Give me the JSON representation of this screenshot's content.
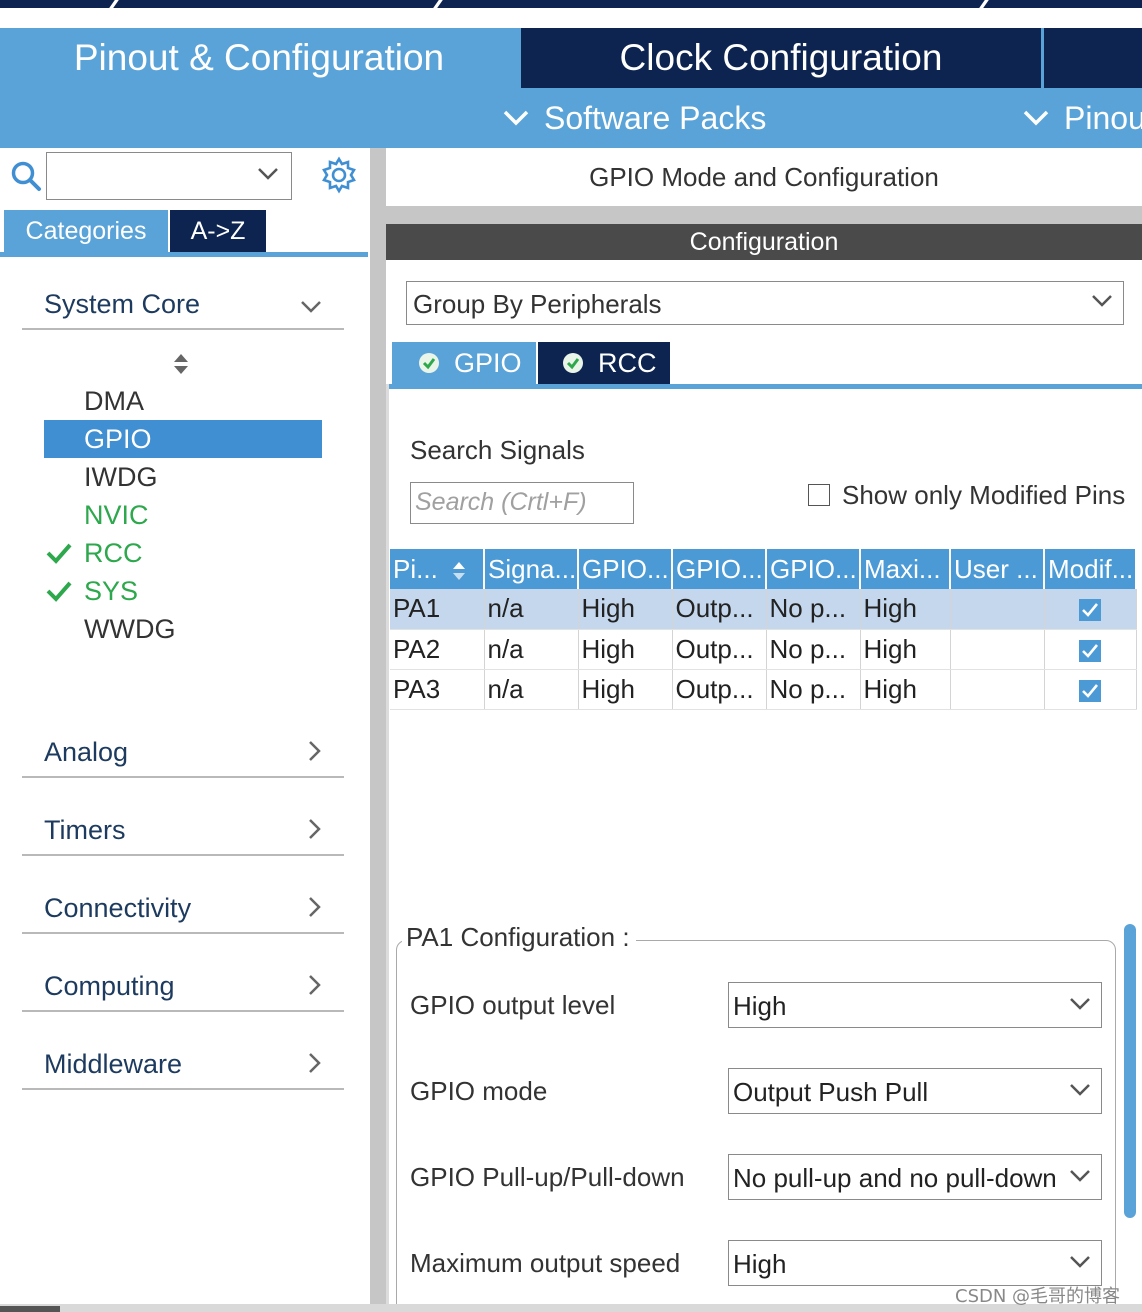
{
  "top_tabs": {
    "pinout": "Pinout & Configuration",
    "clock": "Clock Configuration"
  },
  "sub_menu": {
    "software_packs": "Software Packs",
    "pinout": "Pinou"
  },
  "left": {
    "search_value": "",
    "tabs": {
      "categories": "Categories",
      "az": "A->Z"
    },
    "groups": {
      "system_core": "System Core",
      "analog": "Analog",
      "timers": "Timers",
      "connectivity": "Connectivity",
      "computing": "Computing",
      "middleware": "Middleware"
    },
    "peripherals": [
      "DMA",
      "GPIO",
      "IWDG",
      "NVIC",
      "RCC",
      "SYS",
      "WWDG"
    ]
  },
  "right": {
    "mode_title": "GPIO Mode and Configuration",
    "configuration_bar": "Configuration",
    "group_by": "Group By Peripherals",
    "tabs": {
      "gpio": "GPIO",
      "rcc": "RCC"
    },
    "search_signals_label": "Search Signals",
    "search_placeholder": "Search (Crtl+F)",
    "show_modified_label": "Show only Modified Pins",
    "table": {
      "headers": [
        "Pi...",
        "Signa...",
        "GPIO...",
        "GPIO...",
        "GPIO...",
        "Maxi...",
        "User ...",
        "Modif..."
      ],
      "rows": [
        [
          "PA1",
          "n/a",
          "High",
          "Outp...",
          "No p...",
          "High",
          "",
          "checked"
        ],
        [
          "PA2",
          "n/a",
          "High",
          "Outp...",
          "No p...",
          "High",
          "",
          "checked"
        ],
        [
          "PA3",
          "n/a",
          "High",
          "Outp...",
          "No p...",
          "High",
          "",
          "checked"
        ]
      ]
    },
    "pa1_config": {
      "title": "PA1 Configuration :",
      "output_level_label": "GPIO output level",
      "output_level_value": "High",
      "mode_label": "GPIO mode",
      "mode_value": "Output Push Pull",
      "pull_label": "GPIO Pull-up/Pull-down",
      "pull_value": "No pull-up and no pull-down",
      "speed_label": "Maximum output speed",
      "speed_value": "High"
    }
  },
  "watermark": "CSDN @毛哥的博客",
  "colors": {
    "accent_blue": "#5aa3d8",
    "dark_navy": "#0d2350",
    "selected_row": "#c4d7ec",
    "ok_green": "#2ea84d"
  }
}
